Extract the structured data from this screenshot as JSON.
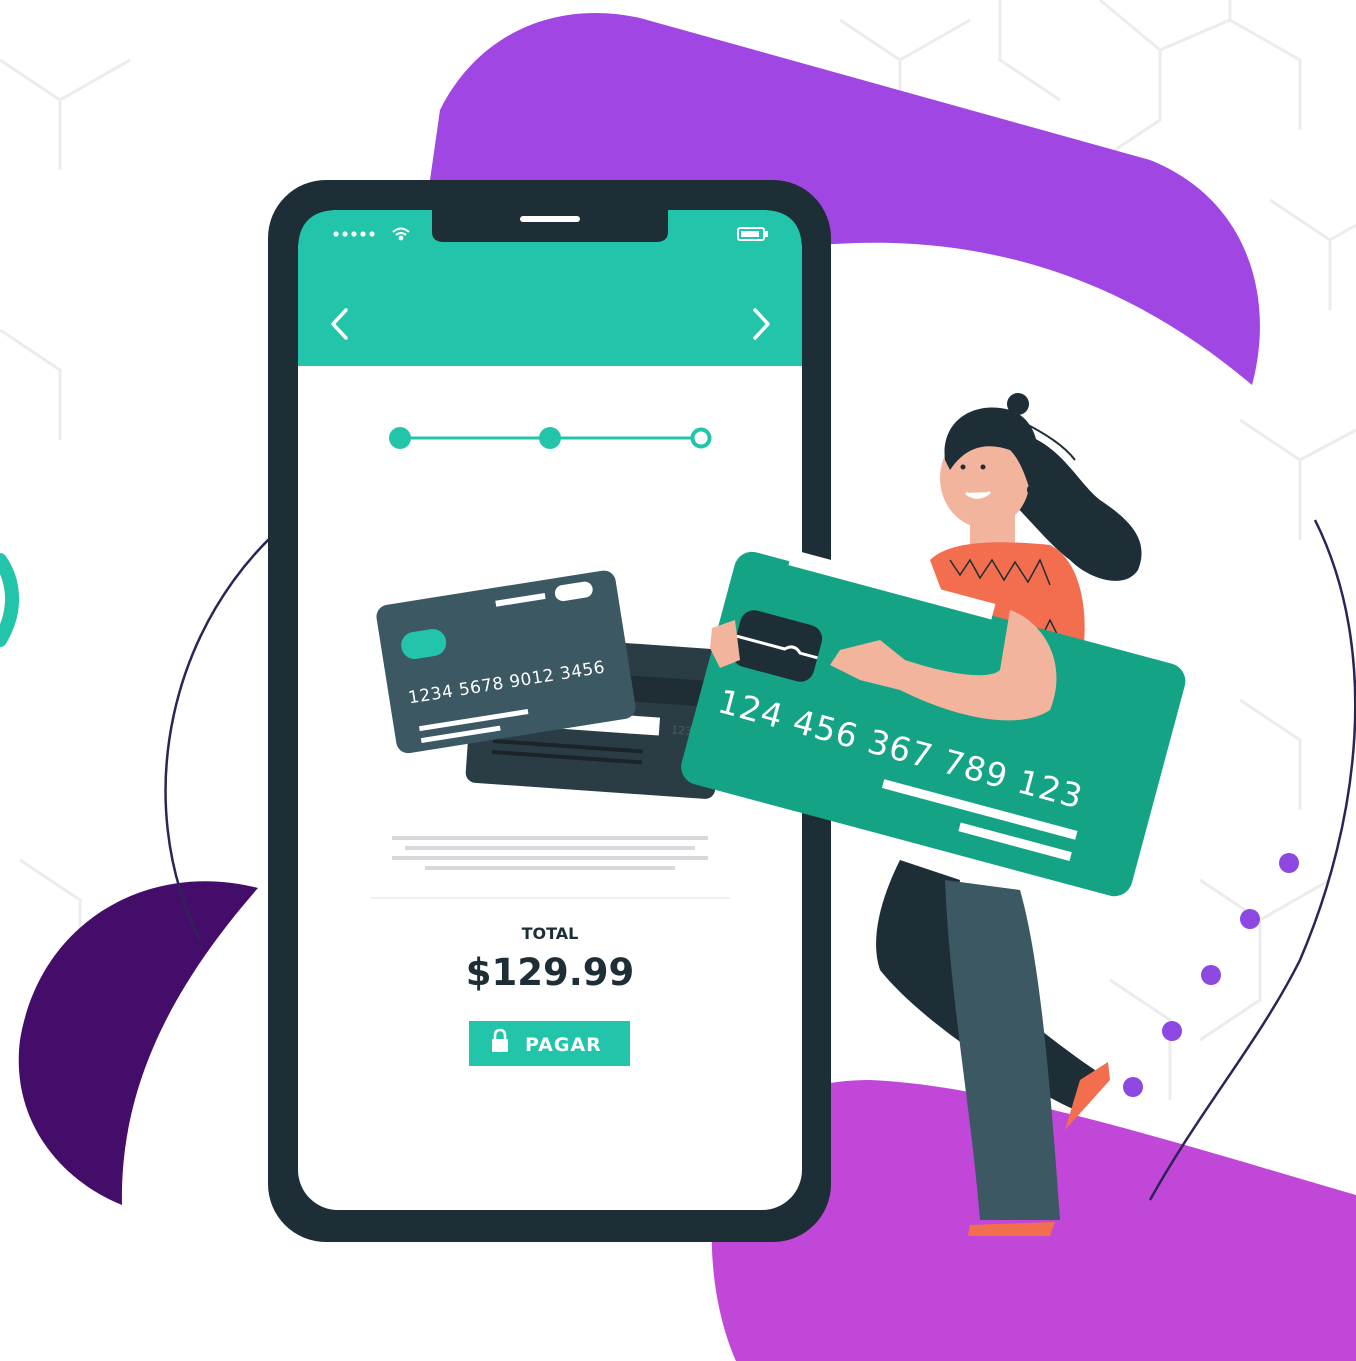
{
  "colors": {
    "brand_teal": "#22c5a9",
    "card_green": "#14a385",
    "purple_top": "#a046e3",
    "purple_bottom": "#c147d8",
    "purple_dark": "#450d6a",
    "phone_frame": "#1e2e36",
    "card_dark": "#3b5863",
    "text_dark": "#1e2e36",
    "dots": "#8c48e0"
  },
  "status_bar": {
    "signal_icon": "signal-dots-icon",
    "wifi_icon": "wifi-icon",
    "battery_icon": "battery-icon"
  },
  "nav": {
    "back_icon": "chevron-left-icon",
    "forward_icon": "chevron-right-icon"
  },
  "stepper": {
    "total_steps": 3,
    "completed_steps": 2
  },
  "cards": {
    "front_number": "1234  5678  9012  3456",
    "back_cvv": "123",
    "big_card_number": "124 456 367 789 123"
  },
  "total": {
    "label": "TOTAL",
    "amount": "$129.99"
  },
  "pay_button": {
    "label": "PAGAR",
    "icon": "lock-icon"
  }
}
